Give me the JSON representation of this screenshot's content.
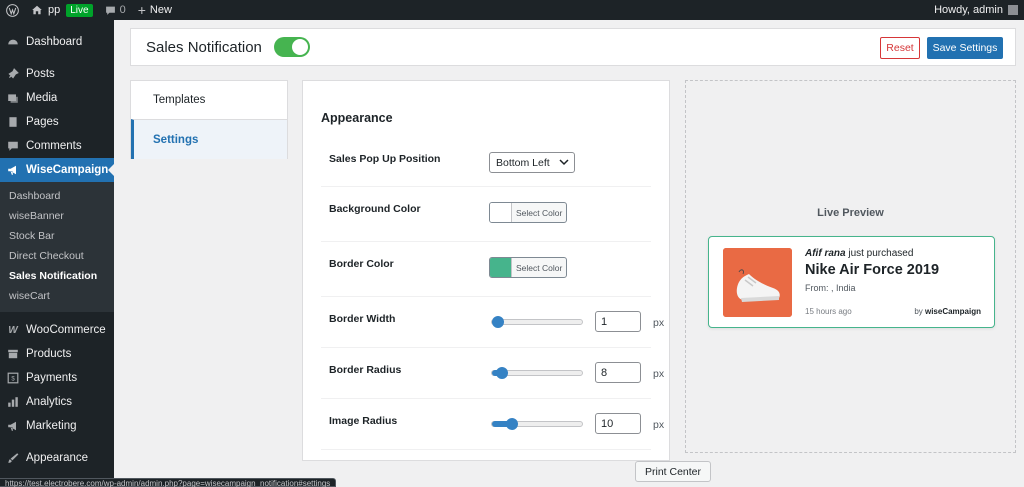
{
  "admin_bar": {
    "site_name": "pp",
    "live_badge": "Live",
    "comments_count": "0",
    "new_label": "New",
    "howdy": "Howdy, admin"
  },
  "sidebar": {
    "items": [
      {
        "label": "Dashboard",
        "icon": "dashboard-icon"
      },
      {
        "label": "Posts",
        "icon": "pin-icon"
      },
      {
        "label": "Media",
        "icon": "media-icon"
      },
      {
        "label": "Pages",
        "icon": "pages-icon"
      },
      {
        "label": "Comments",
        "icon": "comment-icon"
      },
      {
        "label": "WiseCampaign",
        "icon": "megaphone-icon"
      }
    ],
    "submenu": [
      {
        "label": "Dashboard"
      },
      {
        "label": "wiseBanner"
      },
      {
        "label": "Stock Bar"
      },
      {
        "label": "Direct Checkout"
      },
      {
        "label": "Sales Notification"
      },
      {
        "label": "wiseCart"
      }
    ],
    "bottom_items": [
      {
        "label": "WooCommerce",
        "icon": "woo-icon"
      },
      {
        "label": "Products",
        "icon": "archive-icon"
      },
      {
        "label": "Payments",
        "icon": "dollar-icon"
      },
      {
        "label": "Analytics",
        "icon": "bar-chart-icon"
      },
      {
        "label": "Marketing",
        "icon": "megaphone-icon"
      },
      {
        "label": "Appearance",
        "icon": "brush-icon"
      }
    ]
  },
  "header": {
    "title": "Sales Notification",
    "toggle_on": true,
    "reset_label": "Reset",
    "save_label": "Save Settings"
  },
  "tabs": [
    {
      "label": "Templates"
    },
    {
      "label": "Settings"
    }
  ],
  "settings": {
    "section_title": "Appearance",
    "position": {
      "label": "Sales Pop Up Position",
      "value": "Bottom Left"
    },
    "background_color": {
      "label": "Background Color",
      "button": "Select Color",
      "color": "#ffffff"
    },
    "border_color": {
      "label": "Border Color",
      "button": "Select Color",
      "color": "#46b48c"
    },
    "border_width": {
      "label": "Border Width",
      "value": "1",
      "unit": "px",
      "fraction": 0.07
    },
    "border_radius": {
      "label": "Border Radius",
      "value": "8",
      "unit": "px",
      "fraction": 0.11
    },
    "image_radius": {
      "label": "Image Radius",
      "value": "10",
      "unit": "px",
      "fraction": 0.22
    }
  },
  "preview": {
    "title": "Live Preview",
    "buyer_name": "Afif rana",
    "action": " just purchased",
    "product": "Nike Air Force 2019",
    "from": "From: , India",
    "time_ago": "15 hours ago",
    "by_prefix": "by ",
    "by_brand": "wiseCampaign"
  },
  "status_url": "https://test.electrobere.com/wp-admin/admin.php?page=wisecampaign_notification#settings",
  "tooltip": "Print Center",
  "colors": {
    "accent": "#2271b1",
    "toggle": "#46b450",
    "card_border": "#46b48c",
    "danger": "#d63638"
  }
}
